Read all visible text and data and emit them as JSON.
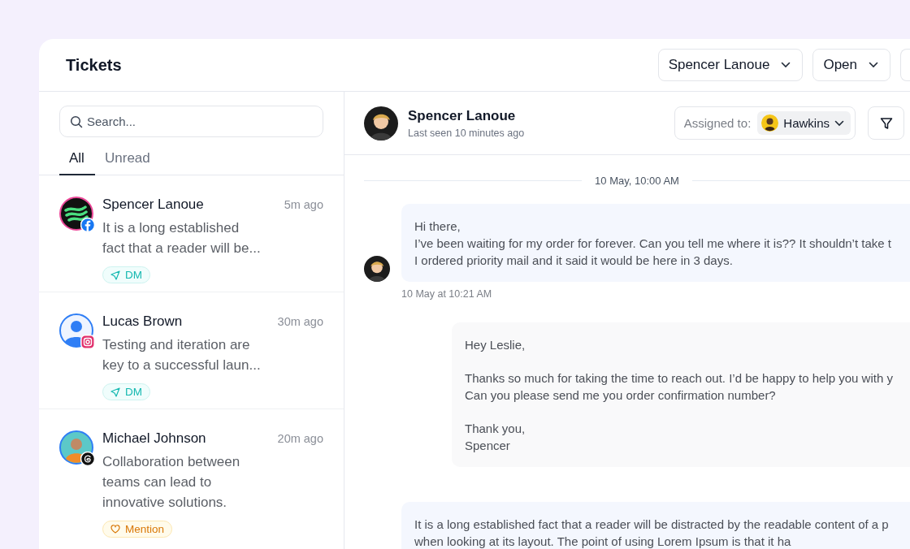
{
  "header": {
    "title": "Tickets",
    "filters": [
      {
        "label": "Spencer Lanoue"
      },
      {
        "label": "Open"
      }
    ]
  },
  "sidebar": {
    "search": {
      "placeholder": "Search..."
    },
    "tabs": [
      {
        "label": "All",
        "selected": true
      },
      {
        "label": "Unread",
        "selected": false
      }
    ],
    "tickets": [
      {
        "name": "Spencer Lanoue",
        "time": "5m ago",
        "preview": "It is a long established fact that a reader will be...",
        "badge": {
          "kind": "facebook"
        },
        "avatar": {
          "kind": "waves"
        },
        "tag": {
          "kind": "dm",
          "label": "DM"
        }
      },
      {
        "name": "Lucas Brown",
        "time": "30m ago",
        "preview": "Testing and iteration are key to a successful laun...",
        "badge": {
          "kind": "instagram"
        },
        "avatar": {
          "kind": "silhouette"
        },
        "tag": {
          "kind": "dm",
          "label": "DM"
        }
      },
      {
        "name": "Michael Johnson",
        "time": "20m ago",
        "preview": "Collaboration between teams can lead to innovative solutions.",
        "badge": {
          "kind": "threads"
        },
        "avatar": {
          "kind": "person"
        },
        "tag": {
          "kind": "mention",
          "label": "Mention"
        }
      }
    ]
  },
  "conversation": {
    "contact": {
      "name": "Spencer Lanoue",
      "status": "Last seen 10 minutes ago"
    },
    "assignee": {
      "label": "Assigned to:",
      "name": "Hawkins"
    },
    "date_divider": "10 May, 10:00 AM",
    "messages": [
      {
        "kind": "customer",
        "paragraphs": [
          [
            "Hi there,",
            "I’ve been waiting for my order for forever. Can you tell me where it is?? It shouldn’t take t",
            "I ordered priority mail and it said it would be here in 3 days."
          ]
        ],
        "time": "10 May at 10:21 AM"
      },
      {
        "kind": "agent",
        "paragraphs": [
          [
            "Hey Leslie,"
          ],
          [
            "Thanks so much for taking the time to reach out. I’d be happy to help you with y",
            "Can you please send me you order confirmation number?"
          ],
          [
            "Thank you,",
            "Spencer"
          ]
        ]
      },
      {
        "kind": "customer",
        "paragraphs": [
          [
            "It is a long established fact that a reader will be distracted by the readable content of a p",
            "when looking at its layout. The point of using Lorem Ipsum is that it ha"
          ]
        ]
      }
    ]
  }
}
